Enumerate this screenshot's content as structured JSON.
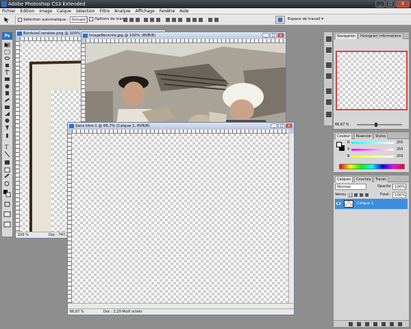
{
  "app": {
    "title": "Adobe Photoshop CS3 Extended",
    "window_buttons": [
      "_",
      "□",
      "X"
    ]
  },
  "menu": [
    "Fichier",
    "Edition",
    "Image",
    "Calque",
    "Sélection",
    "Filtre",
    "Analyse",
    "Affichage",
    "Fenêtre",
    "Aide"
  ],
  "options_bar": {
    "auto_select_label": "Sélection automatique :",
    "auto_select_value": "Groupe",
    "transform_label": "Options de transf.",
    "workspace_label": "Espace de travail"
  },
  "toolbox": {
    "logo": "Ps"
  },
  "docs": {
    "bordure": {
      "title": "BordureCrenelee.png @ 100% (Ta",
      "zoom": "100 %",
      "info": "Doc : 747,2"
    },
    "image": {
      "title": "ImageRecente.jpg @ 100% (RVB/8)"
    },
    "sans_titre": {
      "title": "Sans titre-1 @ 66,7% (Calque 1, RVB/8)",
      "zoom": "66,67 %",
      "info": "Doc : 2,29 Mo/0 octets"
    }
  },
  "navigator": {
    "tabs": [
      "Navigation",
      "Histogramme",
      "Informations"
    ],
    "zoom": "66,67 %",
    "view_box_color": "#e04040"
  },
  "color_panel": {
    "tabs": [
      "Couleur",
      "Nuancier",
      "Styles"
    ],
    "channels": [
      {
        "label": "R",
        "value": "255"
      },
      {
        "label": "V",
        "value": "255"
      },
      {
        "label": "B",
        "value": "255"
      }
    ]
  },
  "layers_panel": {
    "tabs": [
      "Calques",
      "Couches",
      "Tracés"
    ],
    "blend_mode": "Normal",
    "opacity_label": "Opacité :",
    "opacity_value": "100%",
    "lock_label": "Verrou :",
    "fill_label": "Fond :",
    "fill_value": "100%",
    "layers": [
      {
        "name": "Calque 1",
        "visible": true,
        "selected": true
      }
    ],
    "selected_color": "#3d8ee0"
  }
}
